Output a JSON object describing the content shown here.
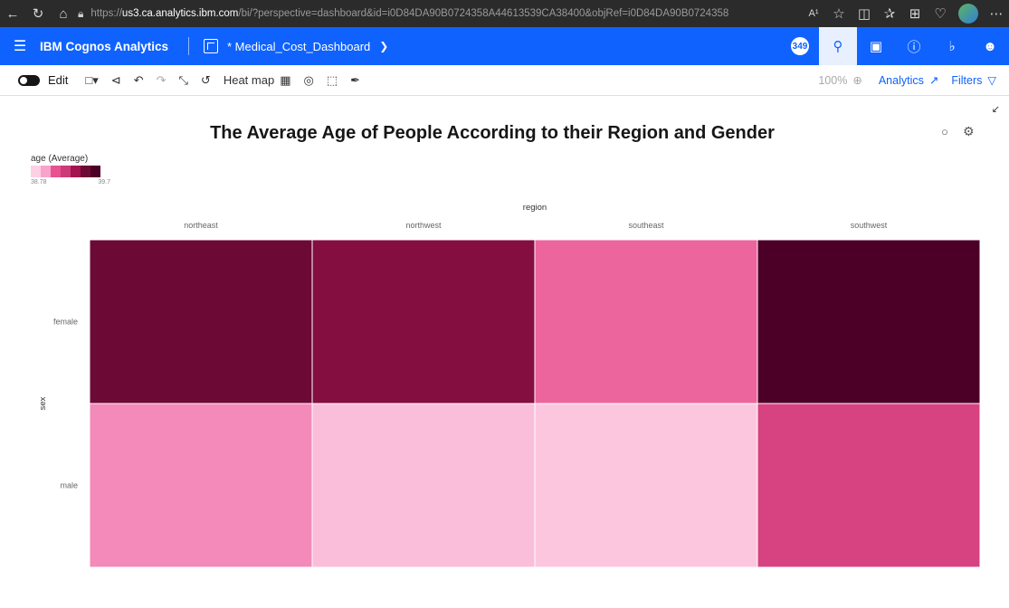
{
  "browser": {
    "url_prefix": "https://",
    "url_host": "us3.ca.analytics.ibm.com",
    "url_rest": "/bi/?perspective=dashboard&id=i0D84DA90B0724358A44613539CA38400&objRef=i0D84DA90B0724358...",
    "read_aloud": "A¹"
  },
  "app": {
    "title": "IBM Cognos Analytics",
    "dashboard_title": "* Medical_Cost_Dashboard",
    "notification_count": "349"
  },
  "toolbar": {
    "edit_label": "Edit",
    "heatmap_label": "Heat map",
    "zoom": "100%",
    "analytics_label": "Analytics",
    "filters_label": "Filters"
  },
  "icons": {
    "browser": [
      "back-icon",
      "refresh-icon",
      "home-icon",
      "lock-icon",
      "favorite-icon",
      "split-icon",
      "favorites-bar-icon",
      "collections-icon",
      "health-icon",
      "more-icon"
    ],
    "header": [
      "hamburger-icon",
      "dashboard-icon",
      "chevron-down-icon",
      "search-icon",
      "chat-icon",
      "help-icon",
      "bell-icon",
      "user-icon"
    ],
    "toolbar": [
      "toggle-icon",
      "save-icon",
      "share-icon",
      "undo-icon",
      "redo-icon",
      "expand-icon",
      "reset-icon",
      "heatmap-grid-icon",
      "target-icon",
      "select-icon",
      "pin-icon",
      "zoom-icon",
      "analytics-icon",
      "filter-icon"
    ],
    "canvas": [
      "collapse-icon",
      "bulb-icon",
      "settings-icon"
    ]
  },
  "chart_data": {
    "type": "heatmap",
    "title": "The Average Age of People According to their Region and Gender",
    "xlabel": "region",
    "ylabel": "sex",
    "x_categories": [
      "northeast",
      "northwest",
      "southeast",
      "southwest"
    ],
    "y_categories": [
      "female",
      "male"
    ],
    "values": [
      [
        39.55,
        39.48,
        39.05,
        39.7
      ],
      [
        38.98,
        38.84,
        38.81,
        39.18
      ]
    ],
    "legend": {
      "title": "age (Average)",
      "min_label": "38.78",
      "max_label": "39.7",
      "min": 38.78,
      "max": 39.7,
      "placement": "top-left"
    },
    "color_ramp": [
      "#fdd0e3",
      "#f8a3cb",
      "#e8528f",
      "#cc3a78",
      "#a4144f",
      "#6d0a35",
      "#4d0027"
    ],
    "grid": false
  }
}
